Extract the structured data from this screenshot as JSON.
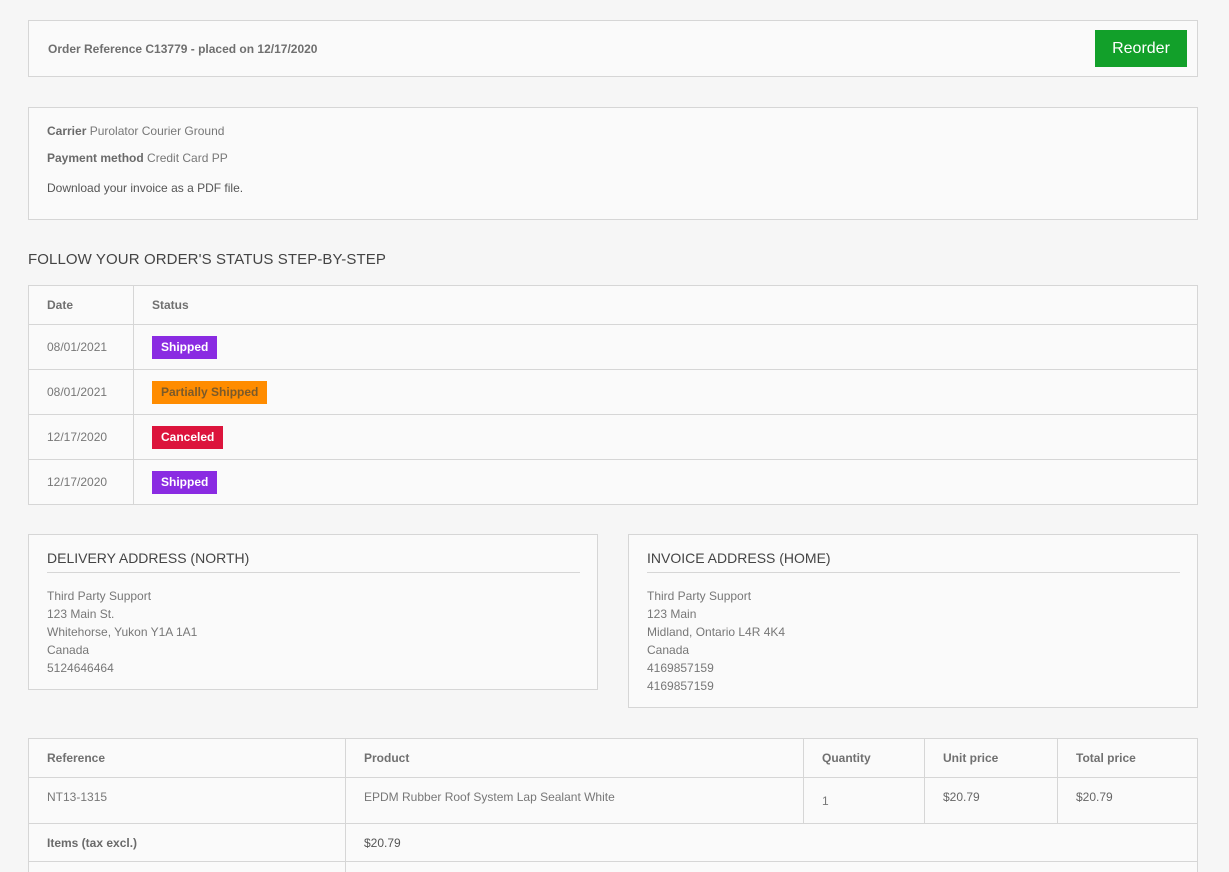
{
  "order": {
    "reference_text": "Order Reference C13779 - placed on 12/17/2020",
    "reorder_label": "Reorder"
  },
  "info": {
    "carrier_label": "Carrier",
    "carrier_value": "Purolator Courier Ground",
    "payment_label": "Payment method",
    "payment_value": "Credit Card PP",
    "download_text": "Download your invoice as a PDF file."
  },
  "status_section": {
    "title": "FOLLOW YOUR ORDER'S STATUS STEP-BY-STEP",
    "headers": [
      "Date",
      "Status"
    ],
    "rows": [
      {
        "date": "08/01/2021",
        "status": "Shipped",
        "color": "#8a2be2",
        "text_color": "#ffffff"
      },
      {
        "date": "08/01/2021",
        "status": "Partially Shipped",
        "color": "#ff8c00",
        "text_color": "#7a5a2a"
      },
      {
        "date": "12/17/2020",
        "status": "Canceled",
        "color": "#dc143c",
        "text_color": "#ffffff"
      },
      {
        "date": "12/17/2020",
        "status": "Shipped",
        "color": "#8a2be2",
        "text_color": "#ffffff"
      }
    ]
  },
  "delivery_address": {
    "title": "DELIVERY ADDRESS (NORTH)",
    "lines": [
      "Third Party Support",
      "123 Main St.",
      "Whitehorse, Yukon Y1A 1A1",
      "Canada",
      "5124646464"
    ]
  },
  "invoice_address": {
    "title": "INVOICE ADDRESS (HOME)",
    "lines": [
      "Third Party Support",
      "123 Main",
      "Midland, Ontario L4R 4K4",
      "Canada",
      "4169857159",
      "4169857159"
    ]
  },
  "products": {
    "headers": [
      "Reference",
      "Product",
      "Quantity",
      "Unit price",
      "Total price"
    ],
    "rows": [
      {
        "reference": "NT13-1315",
        "product": "EPDM Rubber Roof System Lap Sealant White",
        "quantity": "1",
        "unit_price": "$20.79",
        "total_price": "$20.79"
      }
    ],
    "items_label": "Items (tax excl.)",
    "items_value": "$20.79"
  }
}
